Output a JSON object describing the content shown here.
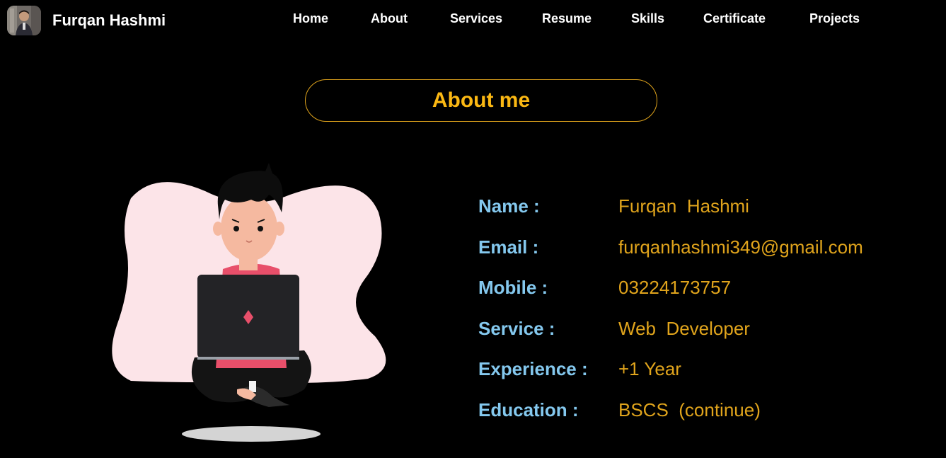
{
  "brand": {
    "name": "Furqan Hashmi"
  },
  "nav": {
    "items": [
      {
        "label": "Home"
      },
      {
        "label": "About"
      },
      {
        "label": "Services"
      },
      {
        "label": "Resume"
      },
      {
        "label": "Skills"
      },
      {
        "label": "Certificate"
      },
      {
        "label": "Projects"
      }
    ]
  },
  "about": {
    "title": "About me",
    "rows": [
      {
        "label": "Name :",
        "value": "Furqan  Hashmi"
      },
      {
        "label": "Email :",
        "value": "furqanhashmi349@gmail.com"
      },
      {
        "label": "Mobile :",
        "value": "03224173757"
      },
      {
        "label": "Service :",
        "value": "Web  Developer"
      },
      {
        "label": "Experience :",
        "value": "+1 Year"
      },
      {
        "label": "Education :",
        "value": "BSCS  (continue)"
      }
    ]
  },
  "colors": {
    "background": "#000000",
    "accent": "#fbb813",
    "label": "#84c8ee",
    "value": "#e0a41c"
  }
}
